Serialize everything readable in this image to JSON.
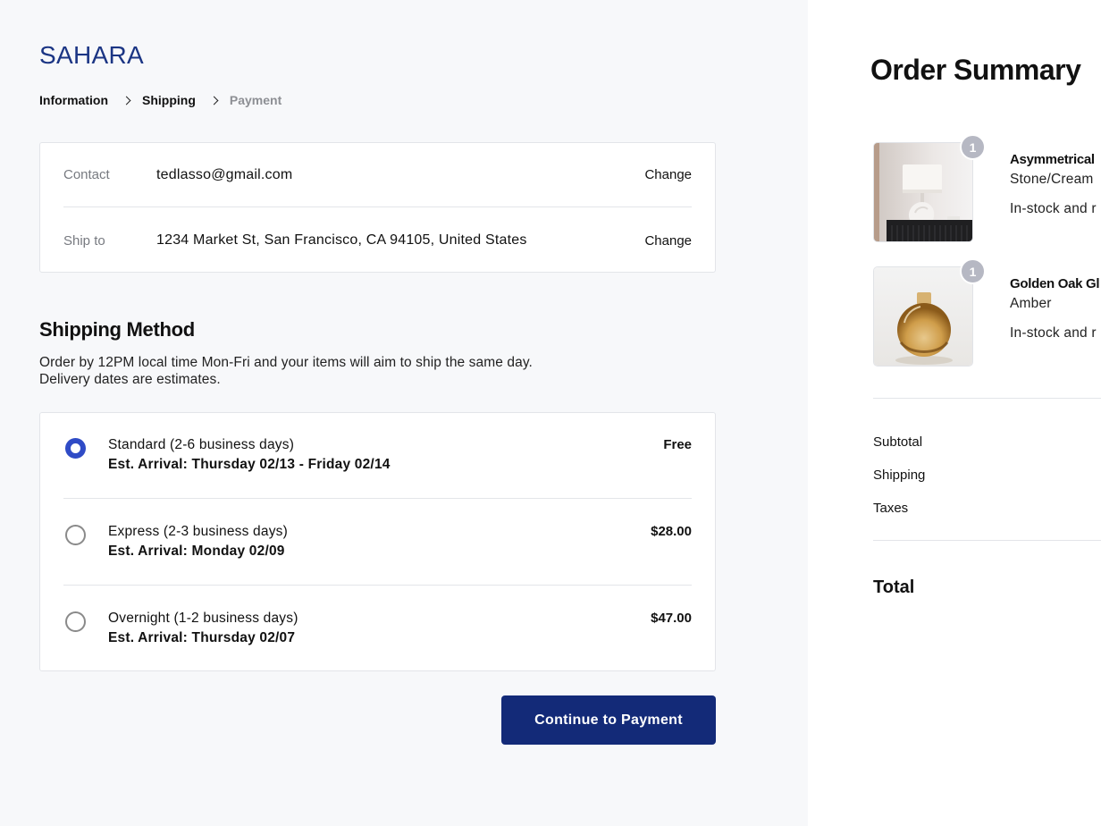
{
  "brand": {
    "name": "SAHARA",
    "color": "#1b3584"
  },
  "breadcrumb": {
    "steps": [
      {
        "label": "Information",
        "state": "done"
      },
      {
        "label": "Shipping",
        "state": "current"
      },
      {
        "label": "Payment",
        "state": "upcoming"
      }
    ],
    "separator_icon": "chevron-right-icon"
  },
  "review": {
    "contact": {
      "label": "Contact",
      "value": "tedlasso@gmail.com",
      "action": "Change"
    },
    "ship_to": {
      "label": "Ship to",
      "value": "1234 Market St, San Francisco, CA 94105, United States",
      "action": "Change"
    }
  },
  "shipping_method": {
    "title": "Shipping Method",
    "description_line1": "Order by 12PM local time Mon-Fri and your items will aim to ship the same day.",
    "description_line2": "Delivery dates are estimates.",
    "selected": "standard",
    "options": [
      {
        "id": "standard",
        "name": "Standard (2-6 business days)",
        "eta": "Est. Arrival: Thursday 02/13 - Friday 02/14",
        "price": "Free"
      },
      {
        "id": "express",
        "name": "Express (2-3 business days)",
        "eta": "Est. Arrival: Monday 02/09",
        "price": "$28.00"
      },
      {
        "id": "overnight",
        "name": "Overnight (1-2 business days)",
        "eta": "Est. Arrival: Thursday 02/07",
        "price": "$47.00"
      }
    ]
  },
  "continue_button": {
    "label": "Continue to Payment",
    "color": "#132a78"
  },
  "order_summary": {
    "title": "Order Summary",
    "items": [
      {
        "name": "Asymmetrical",
        "variant": "Stone/Cream",
        "stock": "In-stock and r",
        "quantity": "1",
        "image": "table-lamp-image"
      },
      {
        "name": "Golden Oak Gl",
        "variant": "Amber",
        "stock": "In-stock and r",
        "quantity": "1",
        "image": "amber-glass-vase-image"
      }
    ],
    "rows": {
      "subtotal": "Subtotal",
      "shipping": "Shipping",
      "taxes": "Taxes"
    },
    "total_label": "Total"
  },
  "colors": {
    "accent_radio": "#2f4bc6",
    "qty_badge": "#b6b8c3",
    "left_panel_bg": "#f7f8fa"
  }
}
